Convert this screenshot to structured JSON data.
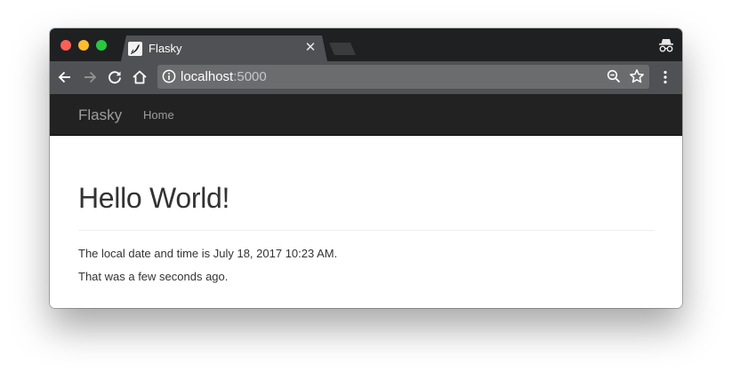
{
  "browser": {
    "tab": {
      "title": "Flasky"
    },
    "address_bar": {
      "host": "localhost",
      "port": ":5000"
    }
  },
  "page": {
    "navbar": {
      "brand": "Flasky",
      "links": [
        {
          "label": "Home"
        }
      ]
    },
    "header": {
      "title": "Hello World!"
    },
    "content": {
      "datetime_text": "The local date and time is July 18, 2017 10:23 AM.",
      "relative_text": "That was a few seconds ago."
    }
  },
  "colors": {
    "tab_bar_bg": "#1f2022",
    "toolbar_bg": "#505154",
    "omnibox_bg": "#6b6c6e",
    "navbar_bg": "#222222",
    "navbar_text": "#9d9d9d",
    "body_text": "#333333"
  },
  "icons": {
    "tab_favicon": "flask-horn-favicon-icon",
    "incognito": "incognito-icon",
    "back": "arrow-left-icon",
    "forward": "arrow-right-icon",
    "reload": "reload-icon",
    "home": "home-icon",
    "info": "info-icon",
    "zoom": "zoom-out-icon",
    "bookmark": "star-icon",
    "menu": "kebab-menu-icon"
  }
}
